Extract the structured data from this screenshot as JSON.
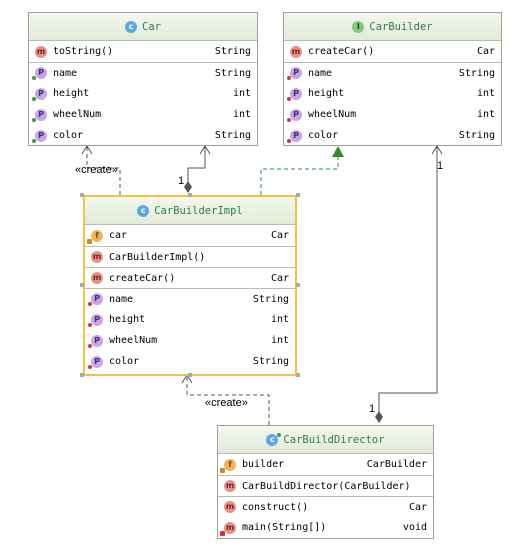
{
  "classes": {
    "car": {
      "title": "Car",
      "kind_icon": "class-icon",
      "rows": [
        {
          "icon": "m",
          "name": "toString()",
          "type": "String"
        },
        {
          "icon": "p",
          "name": "name",
          "type": "String"
        },
        {
          "icon": "p",
          "name": "height",
          "type": "int"
        },
        {
          "icon": "p",
          "name": "wheelNum",
          "type": "int"
        },
        {
          "icon": "p",
          "name": "color",
          "type": "String"
        }
      ]
    },
    "car_builder": {
      "title": "CarBuilder",
      "kind_icon": "interface-icon",
      "rows": [
        {
          "icon": "m",
          "name": "createCar()",
          "type": "Car"
        },
        {
          "icon": "p",
          "name": "name",
          "type": "String"
        },
        {
          "icon": "p",
          "name": "height",
          "type": "int"
        },
        {
          "icon": "p",
          "name": "wheelNum",
          "type": "int"
        },
        {
          "icon": "p",
          "name": "color",
          "type": "String"
        }
      ]
    },
    "car_builder_impl": {
      "title": "CarBuilderImpl",
      "kind_icon": "class-icon",
      "rows": [
        {
          "icon": "f",
          "name": "car",
          "type": "Car"
        },
        {
          "icon": "m",
          "name": "CarBuilderImpl()",
          "type": ""
        },
        {
          "icon": "m",
          "name": "createCar()",
          "type": "Car"
        },
        {
          "icon": "p",
          "name": "name",
          "type": "String"
        },
        {
          "icon": "p",
          "name": "height",
          "type": "int"
        },
        {
          "icon": "p",
          "name": "wheelNum",
          "type": "int"
        },
        {
          "icon": "p",
          "name": "color",
          "type": "String"
        }
      ]
    },
    "car_build_director": {
      "title": "CarBuildDirector",
      "kind_icon": "class-icon",
      "rows": [
        {
          "icon": "f",
          "name": "builder",
          "type": "CarBuilder"
        },
        {
          "icon": "m",
          "name": "CarBuildDirector(CarBuilder)",
          "type": ""
        },
        {
          "icon": "m",
          "name": "construct()",
          "type": "Car"
        },
        {
          "icon": "m",
          "name": "main(String[])",
          "type": "void"
        }
      ]
    }
  },
  "labels": {
    "create_top": "«create»",
    "create_bottom": "«create»",
    "mult_impl_car": "1",
    "mult_car": "1",
    "mult_builder": "1",
    "mult_director": "1"
  },
  "colors": {
    "realization": "#2f8f2f",
    "link": "#555555",
    "selected_border": "#f5c242",
    "title_text": "#2e7d4a"
  }
}
